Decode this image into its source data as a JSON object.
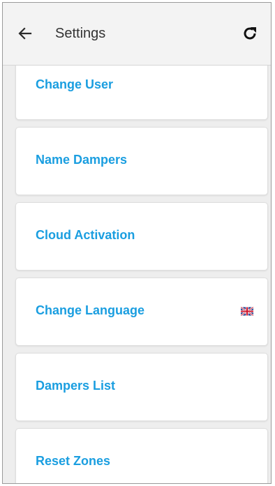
{
  "header": {
    "title": "Settings",
    "back_icon": "arrow-left-icon",
    "refresh_icon": "refresh-icon"
  },
  "colors": {
    "accent": "#1a9ee0",
    "header_bg": "#f3f3f3",
    "content_bg": "#eeeeee"
  },
  "settings": {
    "items": [
      {
        "label": "Change User"
      },
      {
        "label": "Name Dampers"
      },
      {
        "label": "Cloud Activation"
      },
      {
        "label": "Change Language",
        "icon": "uk-flag-icon"
      },
      {
        "label": "Dampers List"
      },
      {
        "label": "Reset Zones"
      }
    ]
  }
}
